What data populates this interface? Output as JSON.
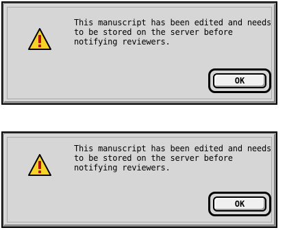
{
  "dialogs": [
    {
      "message": "This manuscript has been edited and needs to be stored on the server before notifying reviewers.",
      "ok_label": "OK",
      "icon": "warning-icon"
    },
    {
      "message": "This manuscript has been edited and needs to be stored on the server before notifying reviewers.",
      "ok_label": "OK",
      "icon": "warning-icon"
    }
  ],
  "colors": {
    "dialog_background": "#d6d6d6",
    "warning_fill": "#f5d328",
    "warning_mark": "#b01313",
    "border": "#000000"
  }
}
